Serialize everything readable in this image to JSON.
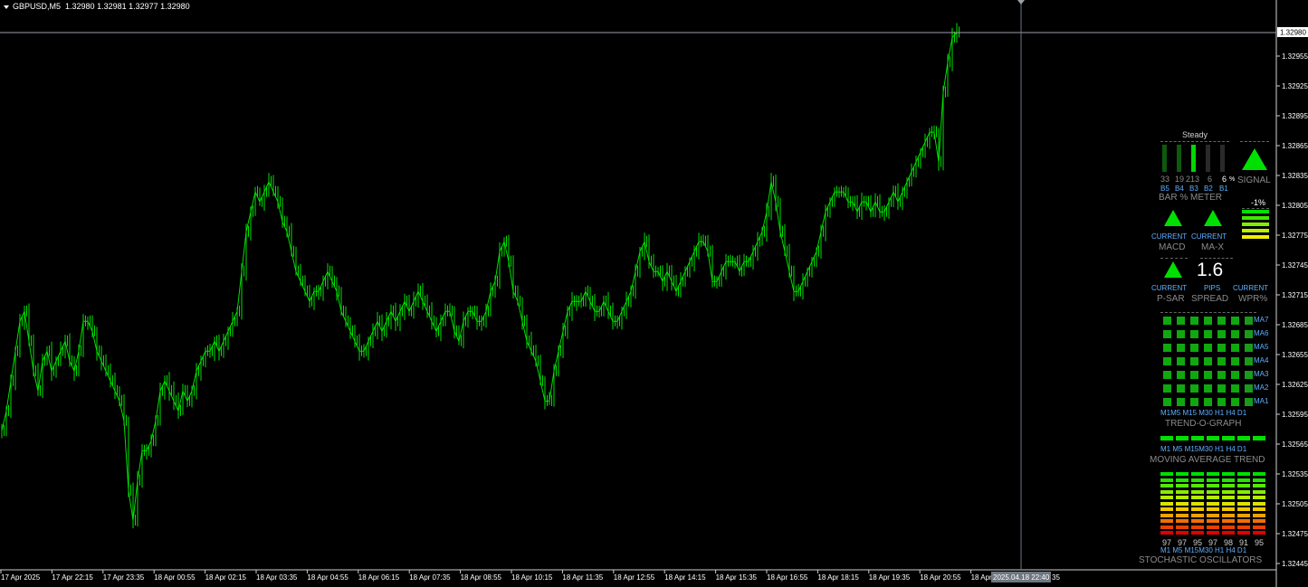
{
  "header": {
    "symbol": "GBPUSD,M5",
    "quotes": "1.32980 1.32981 1.32977 1.32980"
  },
  "chart_data": {
    "type": "line",
    "title": "GBPUSD,M5",
    "color": "#00e000",
    "y_ticks": [
      "1.32980",
      "1.32955",
      "1.32925",
      "1.32895",
      "1.32865",
      "1.32835",
      "1.32805",
      "1.32775",
      "1.32745",
      "1.32715",
      "1.32685",
      "1.32655",
      "1.32625",
      "1.32595",
      "1.32565",
      "1.32535",
      "1.32505",
      "1.32475",
      "1.32445"
    ],
    "current_price": "1.32980",
    "x_ticks": [
      "17 Apr 2025",
      "17 Apr 22:15",
      "17 Apr 23:35",
      "18 Apr 00:55",
      "18 Apr 02:15",
      "18 Apr 03:35",
      "18 Apr 04:55",
      "18 Apr 06:15",
      "18 Apr 07:35",
      "18 Apr 08:55",
      "18 Apr 10:15",
      "18 Apr 11:35",
      "18 Apr 12:55",
      "18 Apr 14:15",
      "18 Apr 15:35",
      "18 Apr 16:55",
      "18 Apr 18:15",
      "18 Apr 19:35",
      "18 Apr 20:55",
      "18 Apr"
    ],
    "crosshair_time": "2025.04.18 22:40",
    "crosshair_tail": "35",
    "ylim": [
      1.3243,
      1.32995
    ],
    "x": [
      0,
      5,
      10,
      15,
      20,
      25,
      30,
      35,
      40,
      45,
      50,
      55,
      60,
      65,
      70,
      75,
      80,
      85,
      90,
      95,
      100,
      105,
      110,
      115,
      120,
      125,
      130,
      135,
      140,
      145,
      150,
      155,
      160,
      165,
      170,
      175,
      180,
      185,
      190,
      195,
      200,
      205,
      210,
      215,
      220,
      225,
      230,
      235,
      240,
      245,
      250,
      255,
      260,
      265,
      270,
      275,
      280,
      285,
      290,
      295,
      300,
      305,
      310,
      315,
      320,
      325,
      330,
      335,
      340,
      345,
      350,
      355,
      360,
      365,
      370,
      375,
      380,
      385,
      390,
      395,
      400,
      405,
      410,
      415,
      420,
      425,
      430,
      435,
      440,
      445,
      450,
      455,
      460,
      465,
      470,
      475,
      480,
      485,
      490,
      495,
      500,
      505,
      510,
      515,
      520,
      525,
      530,
      535,
      540,
      545,
      550,
      555,
      560,
      565,
      570,
      575,
      580,
      585,
      590,
      595,
      600,
      605,
      610,
      615,
      620,
      625,
      630,
      635,
      640,
      645,
      650,
      655,
      660,
      665,
      670,
      675,
      680,
      685,
      690,
      695,
      700,
      705,
      710,
      715,
      720,
      725,
      730,
      735,
      740,
      745,
      750,
      755,
      760,
      765,
      770,
      775,
      780,
      785,
      790,
      795,
      800,
      805,
      810,
      815,
      820,
      825,
      830,
      835,
      840,
      845,
      850,
      855,
      860,
      865,
      870,
      875,
      880,
      885,
      890,
      895,
      900,
      905,
      910,
      915,
      920,
      925,
      930,
      935,
      940,
      945,
      950,
      955,
      960,
      965,
      970,
      975,
      980,
      985,
      990,
      995,
      1000,
      1005,
      1010,
      1015,
      1020,
      1025,
      1030,
      1035,
      1040,
      1045,
      1050,
      1055,
      1060,
      1065,
      1070,
      1075,
      1080,
      1085,
      1090,
      1095,
      1100,
      1105,
      1110,
      1115,
      1120,
      1125
    ],
    "y": [
      1.3258,
      1.326,
      1.3263,
      1.3266,
      1.3269,
      1.327,
      1.3267,
      1.3264,
      1.3262,
      1.3265,
      1.3266,
      1.3264,
      1.3265,
      1.3266,
      1.3267,
      1.3265,
      1.3264,
      1.3266,
      1.3269,
      1.3269,
      1.3268,
      1.3266,
      1.3265,
      1.3264,
      1.3263,
      1.3262,
      1.3261,
      1.3259,
      1.3252,
      1.3249,
      1.3253,
      1.3256,
      1.3256,
      1.3257,
      1.3259,
      1.3262,
      1.3263,
      1.3262,
      1.3261,
      1.326,
      1.3262,
      1.3261,
      1.3262,
      1.3264,
      1.3265,
      1.3266,
      1.3266,
      1.3267,
      1.3266,
      1.3267,
      1.3268,
      1.3269,
      1.327,
      1.3274,
      1.3278,
      1.328,
      1.3282,
      1.3281,
      1.3282,
      1.3283,
      1.3282,
      1.3281,
      1.3279,
      1.3278,
      1.3276,
      1.3274,
      1.3273,
      1.3272,
      1.3271,
      1.3272,
      1.3272,
      1.3273,
      1.3274,
      1.3273,
      1.3272,
      1.327,
      1.3269,
      1.3268,
      1.3267,
      1.3266,
      1.3266,
      1.3267,
      1.3268,
      1.3269,
      1.3268,
      1.3269,
      1.327,
      1.3269,
      1.327,
      1.3271,
      1.327,
      1.3271,
      1.3272,
      1.3271,
      1.327,
      1.3269,
      1.3268,
      1.3269,
      1.327,
      1.327,
      1.3268,
      1.3267,
      1.3269,
      1.327,
      1.327,
      1.3269,
      1.3269,
      1.327,
      1.3272,
      1.3273,
      1.3276,
      1.3277,
      1.3275,
      1.3272,
      1.3271,
      1.3269,
      1.3267,
      1.3266,
      1.3265,
      1.3263,
      1.3261,
      1.3261,
      1.3264,
      1.3266,
      1.3268,
      1.327,
      1.3271,
      1.3271,
      1.3271,
      1.3272,
      1.3271,
      1.327,
      1.327,
      1.3271,
      1.327,
      1.3269,
      1.3269,
      1.327,
      1.3271,
      1.3272,
      1.3274,
      1.3276,
      1.3277,
      1.3275,
      1.3274,
      1.3274,
      1.3273,
      1.3274,
      1.3273,
      1.3272,
      1.3273,
      1.3274,
      1.3275,
      1.3276,
      1.3277,
      1.3277,
      1.3276,
      1.3273,
      1.3273,
      1.3274,
      1.3275,
      1.3275,
      1.3275,
      1.3274,
      1.3275,
      1.3275,
      1.3276,
      1.3277,
      1.3278,
      1.328,
      1.3283,
      1.3281,
      1.3278,
      1.3276,
      1.3274,
      1.3272,
      1.3272,
      1.3273,
      1.3274,
      1.3275,
      1.3276,
      1.3278,
      1.328,
      1.3281,
      1.3282,
      1.3282,
      1.3282,
      1.3281,
      1.3281,
      1.328,
      1.3281,
      1.3281,
      1.328,
      1.3281,
      1.328,
      1.328,
      1.3281,
      1.3282,
      1.3281,
      1.3282,
      1.3283,
      1.3284,
      1.3285,
      1.3286,
      1.3287,
      1.3288,
      1.3288,
      1.3285,
      1.3292,
      1.3295,
      1.32975,
      1.3298
    ]
  },
  "price_axis_labels": [
    "1.32980",
    "1.32955",
    "1.32925",
    "1.32895",
    "1.32865",
    "1.32835",
    "1.32805",
    "1.32775",
    "1.32745",
    "1.32715",
    "1.32685",
    "1.32655",
    "1.32625",
    "1.32595",
    "1.32565",
    "1.32535",
    "1.32505",
    "1.32475",
    "1.32445"
  ],
  "panel": {
    "colors": {
      "green": "#00e000",
      "bar_dark": "#0d5a0d",
      "bar_bright": "#00d800",
      "bar_gray": "#2a2a2a",
      "gray": "#8a8a8a",
      "blue": "#5fb0ff",
      "wpr_yellow": "#f0f000"
    },
    "bar_meter": {
      "title": "Steady",
      "values": [
        "33",
        "19",
        "213",
        "6",
        "6"
      ],
      "unit": "%",
      "labels": [
        "B5",
        "B4",
        "B3",
        "B2",
        "B1"
      ],
      "caption": "BAR % METER"
    },
    "signal": {
      "caption": "SIGNAL",
      "direction": "up"
    },
    "macd": {
      "state": "CURRENT",
      "caption": "MACD",
      "direction": "up"
    },
    "ma_x": {
      "state": "CURRENT",
      "caption": "MA-X",
      "direction": "up"
    },
    "wpr": {
      "value": "-1%",
      "state": "CURRENT",
      "caption": "WPR%"
    },
    "psar": {
      "state": "CURRENT",
      "caption": "P-SAR",
      "direction": "up"
    },
    "spread": {
      "value": "1.6",
      "unit": "PIPS",
      "caption": "SPREAD"
    },
    "trend_graph": {
      "rows": [
        "MA7",
        "MA6",
        "MA5",
        "MA4",
        "MA3",
        "MA2",
        "MA1"
      ],
      "cols": [
        "M1",
        "M5",
        "M15",
        "M30",
        "H1",
        "H4",
        "D1"
      ],
      "col_label_text": "M1M5 M15 M30  H1  H4  D1",
      "caption": "TREND-O-GRAPH"
    },
    "ma_trend": {
      "cols": [
        "M1",
        "M5",
        "M15",
        "M30",
        "H1",
        "H4",
        "D1"
      ],
      "col_label_text": "M1  M5  M15M30  H1  H4  D1",
      "caption": "MOVING AVERAGE TREND"
    },
    "stochastic": {
      "values": [
        "97",
        "97",
        "95",
        "97",
        "98",
        "91",
        "95"
      ],
      "cols": [
        "M1",
        "M5",
        "M15",
        "M30",
        "H1",
        "H4",
        "D1"
      ],
      "col_label_text": "M1  M5 M15M30  H1  H4  D1",
      "caption": "STOCHASTIC OSCILLATORS"
    }
  }
}
